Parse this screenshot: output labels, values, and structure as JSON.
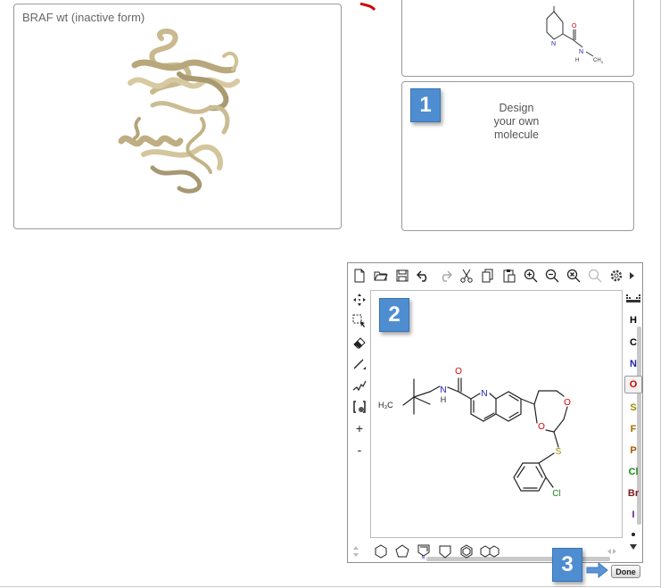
{
  "protein_panel": {
    "title": "BRAF wt (inactive form)"
  },
  "design_panel": {
    "text": "Design\nyour own\nmolecule"
  },
  "steps": {
    "one": "1",
    "two": "2",
    "three": "3"
  },
  "ligand_preview": {
    "atoms": {
      "n_ring": "N",
      "o": "O",
      "nh": "N",
      "h": "H",
      "ch3": "CH",
      "sub3": "3"
    }
  },
  "editor": {
    "top_toolbar": [
      "new-document-icon",
      "open-folder-icon",
      "save-icon",
      "undo-icon",
      "redo-icon",
      "cut-icon",
      "copy-icon",
      "paste-icon",
      "zoom-in-icon",
      "zoom-out-icon",
      "zoom-reset-icon",
      "search-icon",
      "settings-icon",
      "scroll-right-icon"
    ],
    "left_toolbar": [
      "move-icon",
      "select-icon",
      "eraser-icon",
      "bond-icon",
      "chain-icon",
      "bracket-icon",
      "charge-plus-icon",
      "charge-minus-icon"
    ],
    "left_labels": {
      "plus": "+",
      "minus": "-"
    },
    "elements": [
      {
        "symbol": "H",
        "color": "#000000"
      },
      {
        "symbol": "C",
        "color": "#000000"
      },
      {
        "symbol": "N",
        "color": "#1a1ab8"
      },
      {
        "symbol": "O",
        "color": "#d40000"
      },
      {
        "symbol": "S",
        "color": "#9a8a00"
      },
      {
        "symbol": "F",
        "color": "#a86c00"
      },
      {
        "symbol": "P",
        "color": "#a85a00"
      },
      {
        "symbol": "Cl",
        "color": "#1a8a1a"
      },
      {
        "symbol": "Br",
        "color": "#7a1a1a"
      },
      {
        "symbol": "I",
        "color": "#6a1a8a"
      }
    ],
    "active_element": "O",
    "bottom_toolbar": [
      "cyclopropane-icon",
      "cyclohexane-icon",
      "cyclopentane-icon",
      "pyrrole-icon",
      "cyclopentane-open-icon",
      "benzene-icon",
      "naphthalene-icon"
    ],
    "molecule_atoms": {
      "o_amide": "O",
      "n_quinoline": "N",
      "h3c": "H₃C",
      "nh_n": "N",
      "nh_h": "H",
      "o_ring_top": "O",
      "o_ring_left": "O",
      "s": "S",
      "cl": "Cl"
    }
  },
  "done_label": "Done"
}
